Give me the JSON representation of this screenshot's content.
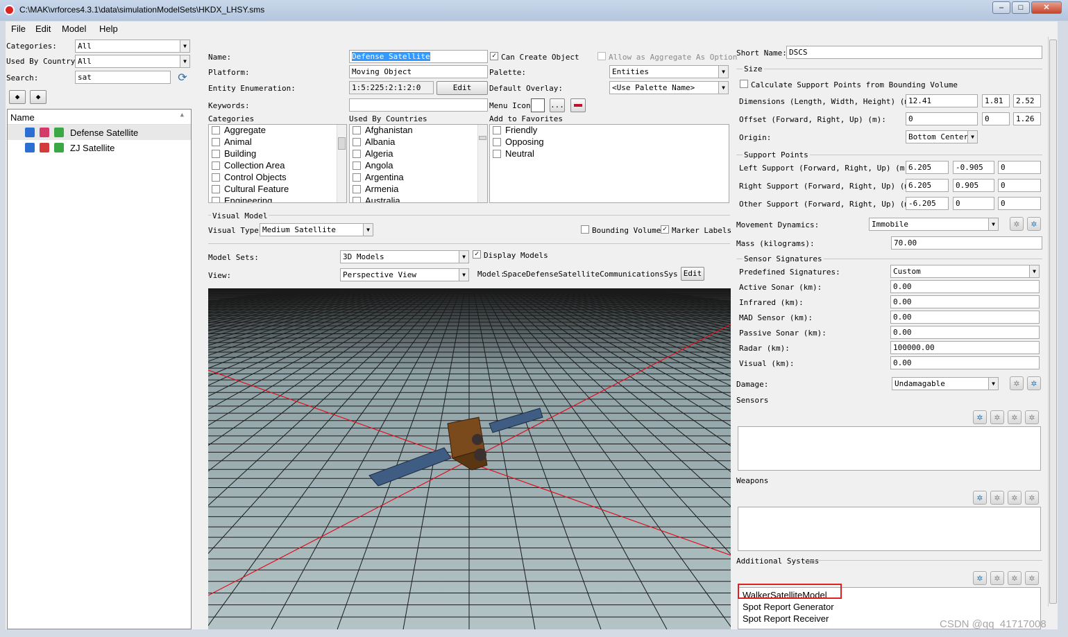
{
  "window": {
    "title": "C:\\MAK\\vrforces4.3.1\\data\\simulationModelSets\\HKDX_LHSY.sms"
  },
  "menu": [
    "File",
    "Edit",
    "Model",
    "Help"
  ],
  "left": {
    "categories_label": "Categories:",
    "categories_value": "All",
    "country_label": "Used By Country:",
    "country_value": "All",
    "search_label": "Search:",
    "search_value": "sat",
    "tree_header": "Name",
    "items": [
      "Defense Satellite",
      "ZJ Satellite"
    ]
  },
  "middle": {
    "name_label": "Name:",
    "name_value": "Defense Satellite",
    "can_create": "Can Create Object",
    "allow_aggregate": "Allow as Aggregate As Option",
    "platform_label": "Platform:",
    "platform_value": "Moving Object",
    "palette_label": "Palette:",
    "palette_value": "Entities",
    "enum_label": "Entity Enumeration:",
    "enum_value": "1:5:225:2:1:2:0",
    "edit": "Edit",
    "overlay_label": "Default Overlay:",
    "overlay_value": "<Use Palette Name>",
    "keywords_label": "Keywords:",
    "menu_icon_label": "Menu Icon",
    "dots": "...",
    "categories_header": "Categories",
    "categories": [
      "Aggregate",
      "Animal",
      "Building",
      "Collection Area",
      "Control Objects",
      "Cultural Feature",
      "Engineering"
    ],
    "countries_header": "Used By Countries",
    "countries": [
      "Afghanistan",
      "Albania",
      "Algeria",
      "Angola",
      "Argentina",
      "Armenia",
      "Australia"
    ],
    "favorites_header": "Add to Favorites",
    "favorites": [
      "Friendly",
      "Opposing",
      "Neutral"
    ],
    "visual_model_group": "Visual Model",
    "visual_type_label": "Visual Type:",
    "visual_type_value": "Medium Satellite",
    "bounding_volume": "Bounding Volume",
    "marker_labels": "Marker Labels",
    "model_sets_label": "Model Sets:",
    "model_sets_value": "3D Models",
    "display_models": "Display Models",
    "view_label": "View:",
    "view_value": "Perspective View",
    "model_label": "Model:",
    "model_value": "SpaceDefenseSatelliteCommunicationsSystem-",
    "model_edit": "Edit"
  },
  "right": {
    "short_name_label": "Short Name:",
    "short_name_value": "DSCS",
    "size_group": "Size",
    "calc_support": "Calculate Support Points from Bounding Volume",
    "dims_label": "Dimensions (Length, Width, Height) (m):",
    "dims": [
      "12.41",
      "1.81",
      "2.52"
    ],
    "offset_label": "Offset (Forward, Right, Up) (m):",
    "offset": [
      "0",
      "0",
      "1.26"
    ],
    "origin_label": "Origin:",
    "origin_value": "Bottom Center",
    "support_group": "Support Points",
    "left_support_label": "Left Support (Forward, Right, Up) (m):",
    "left_support": [
      "6.205",
      "-0.905",
      "0"
    ],
    "right_support_label": "Right Support (Forward, Right, Up) (m):",
    "right_support": [
      "6.205",
      "0.905",
      "0"
    ],
    "other_support_label": "Other Support (Forward, Right, Up) (m):",
    "other_support": [
      "-6.205",
      "0",
      "0"
    ],
    "movement_label": "Movement Dynamics:",
    "movement_value": "Immobile",
    "mass_label": "Mass (kilograms):",
    "mass_value": "70.00",
    "sensor_sig_group": "Sensor Signatures",
    "predefined_label": "Predefined Signatures:",
    "predefined_value": "Custom",
    "sig_rows": [
      {
        "label": "Active Sonar (km):",
        "value": "0.00"
      },
      {
        "label": "Infrared (km):",
        "value": "0.00"
      },
      {
        "label": "MAD Sensor (km):",
        "value": "0.00"
      },
      {
        "label": "Passive Sonar (km):",
        "value": "0.00"
      },
      {
        "label": "Radar (km):",
        "value": "100000.00"
      },
      {
        "label": "Visual (km):",
        "value": "0.00"
      }
    ],
    "damage_label": "Damage:",
    "damage_value": "Undamagable",
    "sensors_label": "Sensors",
    "weapons_label": "Weapons",
    "additional_label": "Additional Systems",
    "additional_items": [
      "WalkerSatelliteModel",
      "Spot Report Generator",
      "Spot Report Receiver"
    ]
  },
  "watermark": "CSDN @qq_41717008",
  "colors": {
    "highlight_box": "#e02020",
    "selection": "#3399ff",
    "grid_line": "#1a1a1a",
    "axis_line": "#e01020"
  }
}
